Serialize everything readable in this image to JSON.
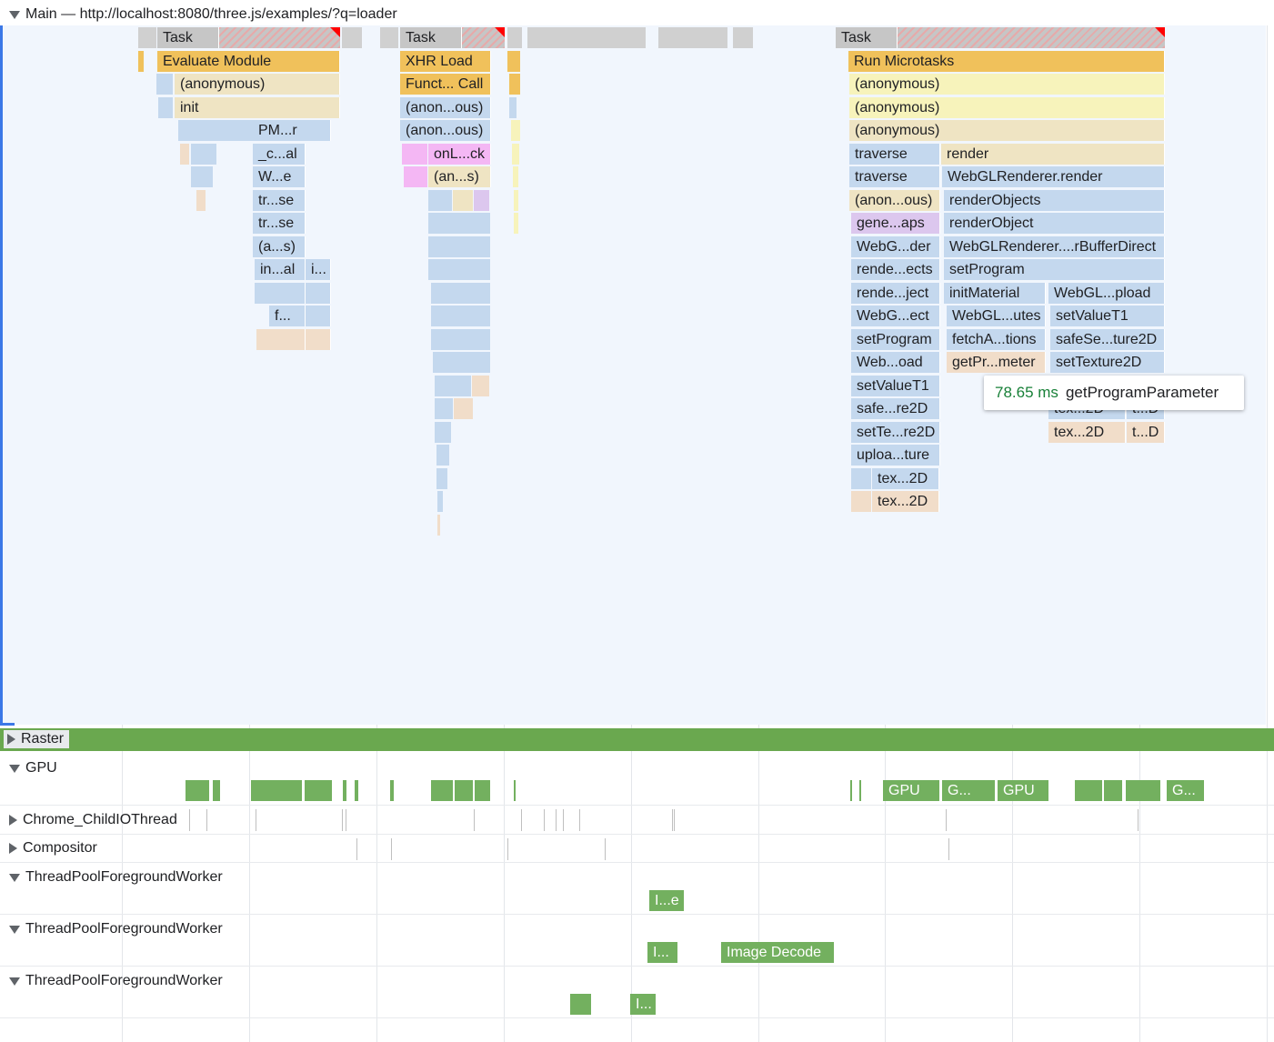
{
  "main": {
    "title": "Main — http://localhost:8080/three.js/examples/?q=loader",
    "task_label": "Task",
    "tasks": [
      {
        "label": "Task",
        "children": [
          "Evaluate Module",
          "(anonymous)",
          "init",
          "PM...r",
          "_c...al",
          "W...e",
          "tr...se",
          "tr...se",
          "(a...s)",
          "in...al",
          "i...",
          "f..."
        ]
      },
      {
        "label": "Task",
        "children": [
          "XHR Load",
          "Funct... Call",
          "(anon...ous)",
          "(anon...ous)",
          "onL...ck",
          "(an...s)"
        ]
      },
      {
        "label": "Task",
        "children": [
          "Run Microtasks",
          "(anonymous)",
          "(anonymous)",
          "(anonymous)",
          "traverse",
          "render",
          "traverse",
          "WebGLRenderer.render",
          "(anon...ous)",
          "renderObjects",
          "gene...aps",
          "renderObject",
          "WebG...der",
          "WebGLRenderer....rBufferDirect",
          "rende...ects",
          "setProgram",
          "rende...ject",
          "initMaterial",
          "WebGL...pload",
          "WebG...ect",
          "WebGL...utes",
          "setValueT1",
          "setProgram",
          "fetchA...tions",
          "safeSe...ture2D",
          "Web...oad",
          "getPr...meter",
          "setTexture2D",
          "setValueT1",
          "safe...re2D",
          "setTe...re2D",
          "uploa...ture",
          "tex...2D",
          "tex...2D",
          "tex...2D",
          "t...D",
          "tex...2D",
          "t...D"
        ]
      }
    ]
  },
  "tooltip": {
    "duration": "78.65 ms",
    "name": "getProgramParameter"
  },
  "tracks": {
    "raster": "Raster",
    "gpu": "GPU",
    "gpu_bars": [
      "GPU",
      "G...",
      "GPU",
      "G..."
    ],
    "chrome_io": "Chrome_ChildIOThread",
    "compositor": "Compositor",
    "worker1": "ThreadPoolForegroundWorker",
    "worker1_bars": [
      "I...e"
    ],
    "worker2": "ThreadPoolForegroundWorker",
    "worker2_bars": [
      "I...",
      "Image Decode"
    ],
    "worker3": "ThreadPoolForegroundWorker",
    "worker3_bars": [
      "I..."
    ]
  },
  "colors": {
    "task": "#c6c6c6",
    "script_yellow": "#f0c15b",
    "js_beige": "#efe4c3",
    "js_blue": "#c4d8ee",
    "gpu_green": "#73b05f",
    "raster_green": "#6aa84f",
    "selection_blue": "#3b78e7",
    "long_task_red": "#ff0000"
  }
}
